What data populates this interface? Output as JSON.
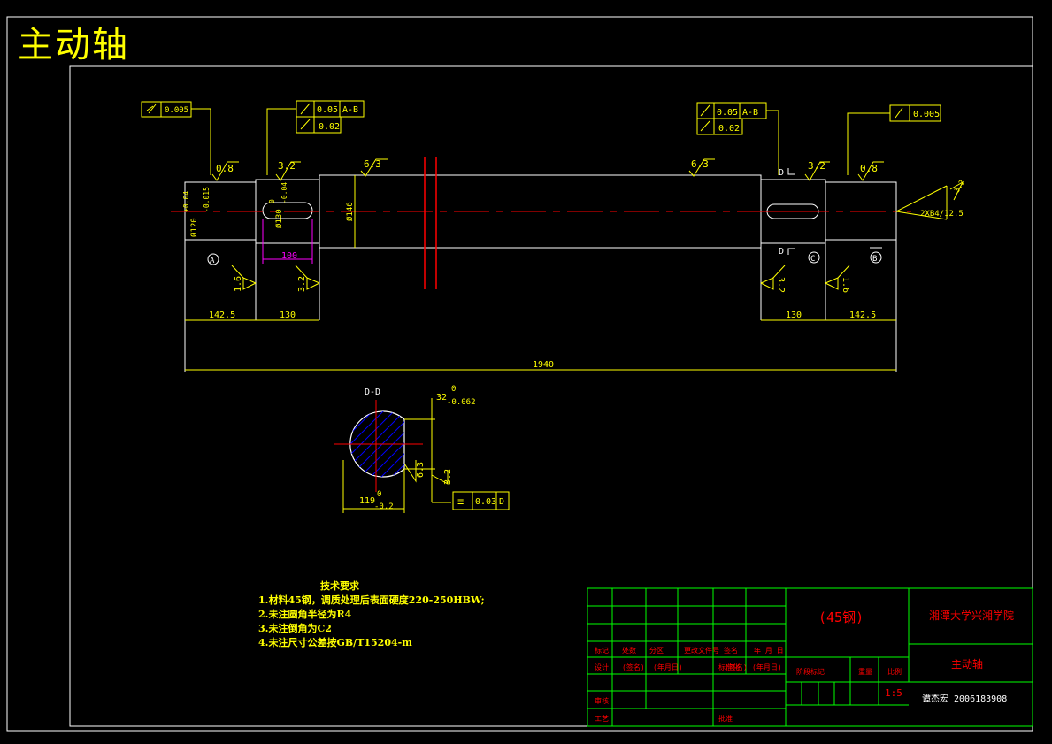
{
  "title": "主动轴",
  "tolerances": {
    "left_cyl": "0.005",
    "left_runout": "0.05",
    "left_runout_ref": "A-B",
    "left_cyl2": "0.02",
    "right_runout": "0.05",
    "right_runout_ref": "A-B",
    "right_cyl2": "0.02",
    "right_cyl": "0.005"
  },
  "roughness": {
    "r1": "0.8",
    "r2": "3.2",
    "r3": "6.3",
    "r4": "6.3",
    "r5": "3.2",
    "r6": "0.8",
    "r7": "1.6",
    "r8": "3.2",
    "r9": "3.2",
    "r10": "1.6",
    "r11": "6.3",
    "r12": "3.2"
  },
  "datums": {
    "a": "A",
    "b": "B",
    "c": "C",
    "d": "D",
    "d2": "D",
    "d3": "D"
  },
  "dimensions": {
    "dia_left_top": "+0.04",
    "dia_left_bot": "-0.015",
    "dia_left": "Ø120",
    "dia_key_top": "0",
    "dia_key_bot": "-0.04",
    "dia_key": "Ø130",
    "dia_mid": "Ø146",
    "key_len": "100",
    "len_142": "142.5",
    "len_130": "130",
    "len_130_r": "130",
    "len_142_r": "142.5",
    "total": "1940",
    "center_hole": "2XB4/12.5"
  },
  "section": {
    "label": "D-D",
    "width_val": "32",
    "width_top": "0",
    "width_bot": "-0.062",
    "depth_val": "119",
    "depth_top": "0",
    "depth_bot": "-0.2",
    "sym_tol": "0.03",
    "sym_ref": "D"
  },
  "tech": {
    "title": "技术要求",
    "items": [
      "1.材料45钢，调质处理后表面硬度220-250HBW;",
      "2.未注圆角半径为R4",
      "3.未注倒角为C2",
      "4.未注尺寸公差按GB/T15204-m"
    ]
  },
  "titleblock": {
    "material": "(45钢)",
    "school": "湘潭大学兴湘学院",
    "part_name": "主动轴",
    "scale": "1:5",
    "author": "谭杰宏 2006183908",
    "h1": "标记",
    "h2": "处数",
    "h3": "分区",
    "h4": "更改文件号",
    "h5": "签名",
    "h6": "年 月 日",
    "d1": "设计",
    "d2": "(签名)",
    "d3": "(年月日)",
    "d4": "标准化",
    "d5": "(签名)",
    "d6": "(年月日)",
    "stage": "阶段标记",
    "weight": "重量",
    "scale_label": "比例",
    "check": "审核",
    "process": "工艺",
    "approve": "批准"
  },
  "colors": {
    "line": "#ffffff",
    "dim": "#ffff00",
    "center": "#ff0000",
    "key": "#ff00ff",
    "hatch": "#0000ff",
    "table": "#00ff00"
  }
}
